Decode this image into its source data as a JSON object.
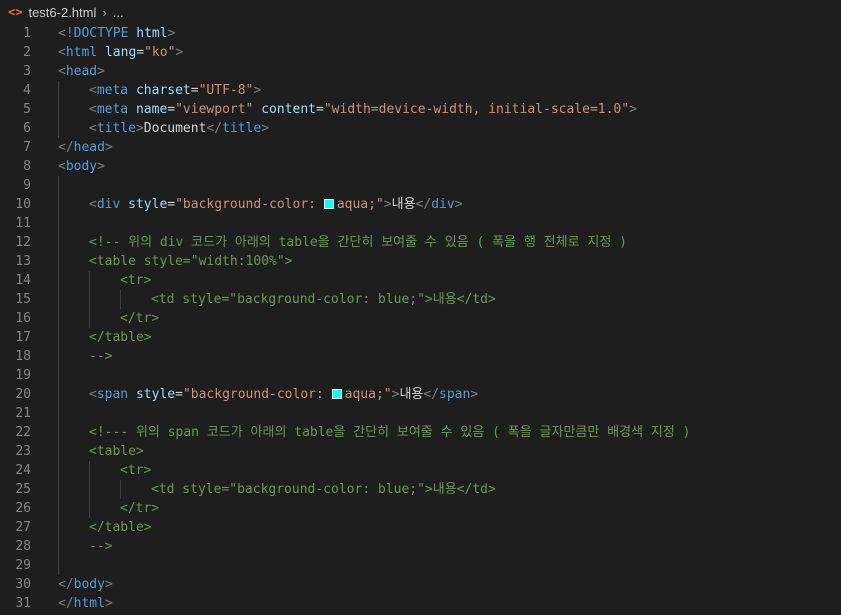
{
  "breadcrumb": {
    "icon": "html-file-icon",
    "file": "test6-2.html",
    "sep": "›",
    "more": "..."
  },
  "colors": {
    "background": "#1e1e1e",
    "tag": "#569cd6",
    "attribute": "#9cdcfe",
    "string": "#ce9178",
    "comment": "#6a9955",
    "text": "#d4d4d4",
    "swatch_aqua": "#00ffff"
  },
  "lines": [
    {
      "n": "1",
      "indent": 0,
      "tokens": [
        [
          "p",
          "<!"
        ],
        [
          "d",
          "DOCTYPE"
        ],
        [
          "t",
          " "
        ],
        [
          "a",
          "html"
        ],
        [
          "p",
          ">"
        ]
      ]
    },
    {
      "n": "2",
      "indent": 0,
      "tokens": [
        [
          "p",
          "<"
        ],
        [
          "g",
          "html"
        ],
        [
          "t",
          " "
        ],
        [
          "a",
          "lang"
        ],
        [
          "t",
          "="
        ],
        [
          "s",
          "\"ko\""
        ],
        [
          "p",
          ">"
        ]
      ]
    },
    {
      "n": "3",
      "indent": 0,
      "tokens": [
        [
          "p",
          "<"
        ],
        [
          "g",
          "head"
        ],
        [
          "p",
          ">"
        ]
      ]
    },
    {
      "n": "4",
      "indent": 1,
      "tokens": [
        [
          "p",
          "<"
        ],
        [
          "g",
          "meta"
        ],
        [
          "t",
          " "
        ],
        [
          "a",
          "charset"
        ],
        [
          "t",
          "="
        ],
        [
          "s",
          "\"UTF-8\""
        ],
        [
          "p",
          ">"
        ]
      ]
    },
    {
      "n": "5",
      "indent": 1,
      "tokens": [
        [
          "p",
          "<"
        ],
        [
          "g",
          "meta"
        ],
        [
          "t",
          " "
        ],
        [
          "a",
          "name"
        ],
        [
          "t",
          "="
        ],
        [
          "s",
          "\"viewport\""
        ],
        [
          "t",
          " "
        ],
        [
          "a",
          "content"
        ],
        [
          "t",
          "="
        ],
        [
          "s",
          "\"width=device-width, initial-scale=1.0\""
        ],
        [
          "p",
          ">"
        ]
      ]
    },
    {
      "n": "6",
      "indent": 1,
      "tokens": [
        [
          "p",
          "<"
        ],
        [
          "g",
          "title"
        ],
        [
          "p",
          ">"
        ],
        [
          "t",
          "Document"
        ],
        [
          "p",
          "</"
        ],
        [
          "g",
          "title"
        ],
        [
          "p",
          ">"
        ]
      ]
    },
    {
      "n": "7",
      "indent": 0,
      "tokens": [
        [
          "p",
          "</"
        ],
        [
          "g",
          "head"
        ],
        [
          "p",
          ">"
        ]
      ]
    },
    {
      "n": "8",
      "indent": 0,
      "tokens": [
        [
          "p",
          "<"
        ],
        [
          "g",
          "body"
        ],
        [
          "p",
          ">"
        ]
      ]
    },
    {
      "n": "9",
      "indent": 0,
      "tokens": []
    },
    {
      "n": "10",
      "indent": 1,
      "tokens": [
        [
          "p",
          "<"
        ],
        [
          "g",
          "div"
        ],
        [
          "t",
          " "
        ],
        [
          "a",
          "style"
        ],
        [
          "t",
          "="
        ],
        [
          "s",
          "\"background-color: "
        ],
        [
          "sw",
          ""
        ],
        [
          "s",
          "aqua;\""
        ],
        [
          "p",
          ">"
        ],
        [
          "t",
          "내용"
        ],
        [
          "p",
          "</"
        ],
        [
          "g",
          "div"
        ],
        [
          "p",
          ">"
        ]
      ]
    },
    {
      "n": "11",
      "indent": 0,
      "tokens": []
    },
    {
      "n": "12",
      "indent": 1,
      "tokens": [
        [
          "c",
          "<!-- 위의 div 코드가 아래의 table을 간단히 보여줄 수 있음 ( 폭을 행 전체로 지정 )"
        ]
      ]
    },
    {
      "n": "13",
      "indent": 1,
      "tokens": [
        [
          "c",
          "<table style=\"width:100%\">"
        ]
      ]
    },
    {
      "n": "14",
      "indent": 2,
      "tokens": [
        [
          "c",
          "<tr>"
        ]
      ]
    },
    {
      "n": "15",
      "indent": 3,
      "tokens": [
        [
          "c",
          "<td style=\"background-color: blue;\">내용</td>"
        ]
      ]
    },
    {
      "n": "16",
      "indent": 2,
      "tokens": [
        [
          "c",
          "</tr>"
        ]
      ]
    },
    {
      "n": "17",
      "indent": 1,
      "tokens": [
        [
          "c",
          "</table>"
        ]
      ]
    },
    {
      "n": "18",
      "indent": 1,
      "tokens": [
        [
          "c",
          "-->"
        ]
      ]
    },
    {
      "n": "19",
      "indent": 0,
      "tokens": []
    },
    {
      "n": "20",
      "indent": 1,
      "tokens": [
        [
          "p",
          "<"
        ],
        [
          "g",
          "span"
        ],
        [
          "t",
          " "
        ],
        [
          "a",
          "style"
        ],
        [
          "t",
          "="
        ],
        [
          "s",
          "\"background-color: "
        ],
        [
          "sw",
          ""
        ],
        [
          "s",
          "aqua;\""
        ],
        [
          "p",
          ">"
        ],
        [
          "t",
          "내용"
        ],
        [
          "p",
          "</"
        ],
        [
          "g",
          "span"
        ],
        [
          "p",
          ">"
        ]
      ]
    },
    {
      "n": "21",
      "indent": 0,
      "tokens": []
    },
    {
      "n": "22",
      "indent": 1,
      "tokens": [
        [
          "c",
          "<!--- 위의 span 코드가 아래의 table을 간단히 보여줄 수 있음 ( 폭을 글자만큼만 배경색 지정 )"
        ]
      ]
    },
    {
      "n": "23",
      "indent": 1,
      "tokens": [
        [
          "c",
          "<table>"
        ]
      ]
    },
    {
      "n": "24",
      "indent": 2,
      "tokens": [
        [
          "c",
          "<tr>"
        ]
      ]
    },
    {
      "n": "25",
      "indent": 3,
      "tokens": [
        [
          "c",
          "<td style=\"background-color: blue;\">내용</td>"
        ]
      ]
    },
    {
      "n": "26",
      "indent": 2,
      "tokens": [
        [
          "c",
          "</tr>"
        ]
      ]
    },
    {
      "n": "27",
      "indent": 1,
      "tokens": [
        [
          "c",
          "</table>"
        ]
      ]
    },
    {
      "n": "28",
      "indent": 1,
      "tokens": [
        [
          "c",
          "-->"
        ]
      ]
    },
    {
      "n": "29",
      "indent": 0,
      "tokens": []
    },
    {
      "n": "30",
      "indent": 0,
      "tokens": [
        [
          "p",
          "</"
        ],
        [
          "g",
          "body"
        ],
        [
          "p",
          ">"
        ]
      ]
    },
    {
      "n": "31",
      "indent": 0,
      "tokens": [
        [
          "p",
          "</"
        ],
        [
          "g",
          "html"
        ],
        [
          "p",
          ">"
        ]
      ]
    }
  ]
}
